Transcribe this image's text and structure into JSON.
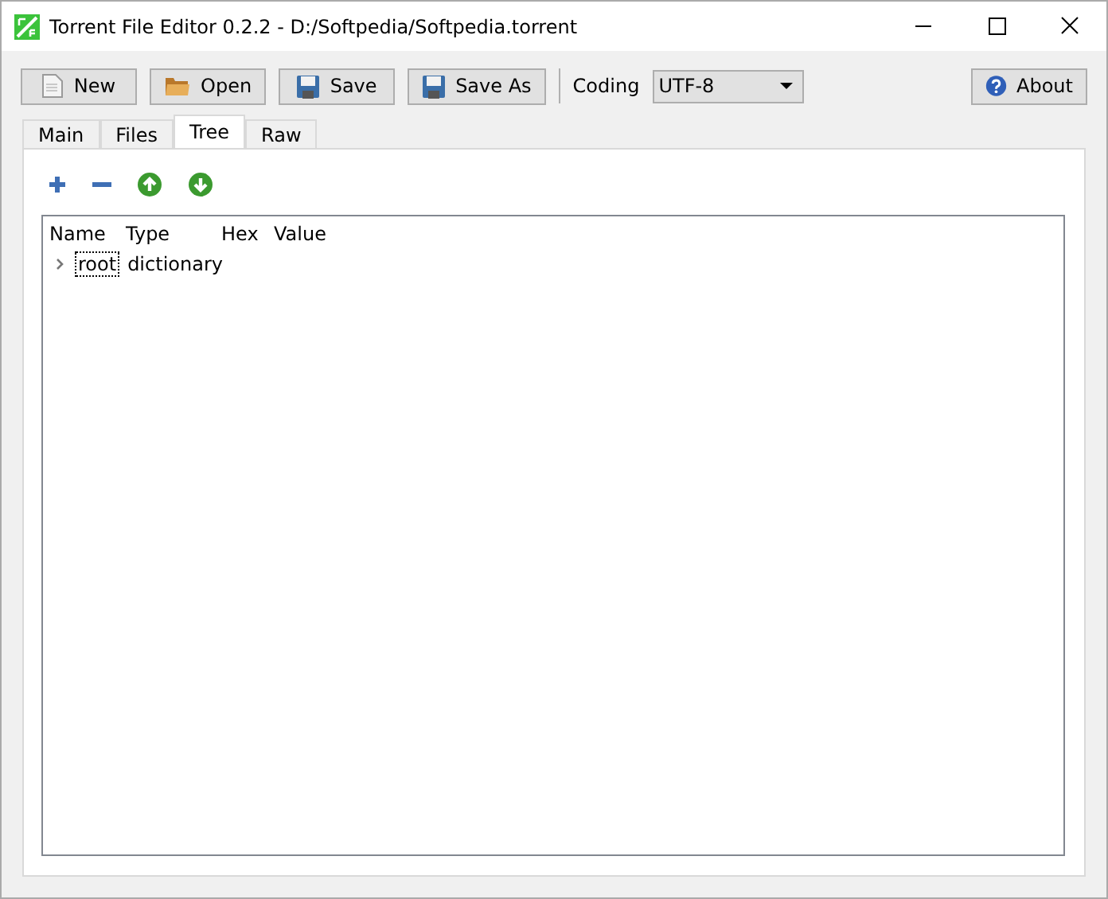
{
  "window": {
    "title": "Torrent File Editor 0.2.2 - D:/Softpedia/Softpedia.torrent"
  },
  "toolbar": {
    "buttons": [
      {
        "label": "New",
        "kind": "new"
      },
      {
        "label": "Open",
        "kind": "open"
      },
      {
        "label": "Save",
        "kind": "save"
      },
      {
        "label": "Save As",
        "kind": "save"
      }
    ],
    "coding": {
      "label": "Coding",
      "value": "UTF-8"
    },
    "about": {
      "label": "About",
      "kind": "help"
    }
  },
  "tabs": [
    {
      "label": "Main",
      "selected": false
    },
    {
      "label": "Files",
      "selected": false
    },
    {
      "label": "Tree",
      "selected": true
    },
    {
      "label": "Raw",
      "selected": false
    }
  ],
  "tree_actions": [
    {
      "kind": "add"
    },
    {
      "kind": "remove"
    },
    {
      "kind": "up"
    },
    {
      "kind": "down"
    }
  ],
  "tree": {
    "columns": [
      "Name",
      "Type",
      "Hex",
      "Value"
    ],
    "rows": [
      {
        "name": "root",
        "type": "dictionary",
        "expanded": false,
        "focused": true
      }
    ]
  }
}
